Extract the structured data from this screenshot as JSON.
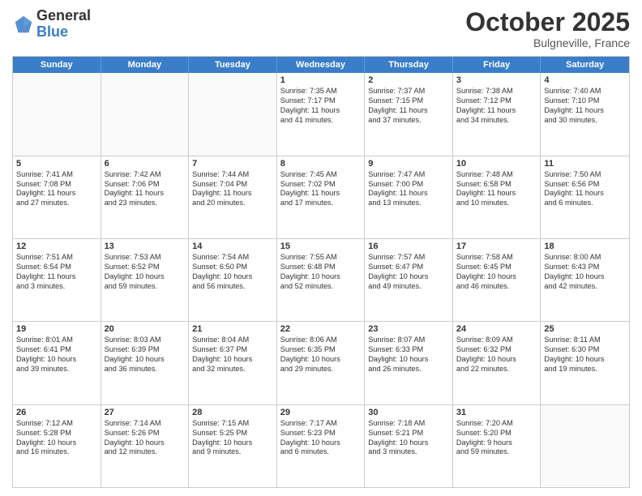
{
  "header": {
    "logo_general": "General",
    "logo_blue": "Blue",
    "month": "October 2025",
    "location": "Bulgneville, France"
  },
  "days_of_week": [
    "Sunday",
    "Monday",
    "Tuesday",
    "Wednesday",
    "Thursday",
    "Friday",
    "Saturday"
  ],
  "rows": [
    [
      {
        "day": "",
        "lines": [],
        "empty": true
      },
      {
        "day": "",
        "lines": [],
        "empty": true
      },
      {
        "day": "",
        "lines": [],
        "empty": true
      },
      {
        "day": "1",
        "lines": [
          "Sunrise: 7:35 AM",
          "Sunset: 7:17 PM",
          "Daylight: 11 hours",
          "and 41 minutes."
        ]
      },
      {
        "day": "2",
        "lines": [
          "Sunrise: 7:37 AM",
          "Sunset: 7:15 PM",
          "Daylight: 11 hours",
          "and 37 minutes."
        ]
      },
      {
        "day": "3",
        "lines": [
          "Sunrise: 7:38 AM",
          "Sunset: 7:12 PM",
          "Daylight: 11 hours",
          "and 34 minutes."
        ]
      },
      {
        "day": "4",
        "lines": [
          "Sunrise: 7:40 AM",
          "Sunset: 7:10 PM",
          "Daylight: 11 hours",
          "and 30 minutes."
        ]
      }
    ],
    [
      {
        "day": "5",
        "lines": [
          "Sunrise: 7:41 AM",
          "Sunset: 7:08 PM",
          "Daylight: 11 hours",
          "and 27 minutes."
        ]
      },
      {
        "day": "6",
        "lines": [
          "Sunrise: 7:42 AM",
          "Sunset: 7:06 PM",
          "Daylight: 11 hours",
          "and 23 minutes."
        ]
      },
      {
        "day": "7",
        "lines": [
          "Sunrise: 7:44 AM",
          "Sunset: 7:04 PM",
          "Daylight: 11 hours",
          "and 20 minutes."
        ]
      },
      {
        "day": "8",
        "lines": [
          "Sunrise: 7:45 AM",
          "Sunset: 7:02 PM",
          "Daylight: 11 hours",
          "and 17 minutes."
        ]
      },
      {
        "day": "9",
        "lines": [
          "Sunrise: 7:47 AM",
          "Sunset: 7:00 PM",
          "Daylight: 11 hours",
          "and 13 minutes."
        ]
      },
      {
        "day": "10",
        "lines": [
          "Sunrise: 7:48 AM",
          "Sunset: 6:58 PM",
          "Daylight: 11 hours",
          "and 10 minutes."
        ]
      },
      {
        "day": "11",
        "lines": [
          "Sunrise: 7:50 AM",
          "Sunset: 6:56 PM",
          "Daylight: 11 hours",
          "and 6 minutes."
        ]
      }
    ],
    [
      {
        "day": "12",
        "lines": [
          "Sunrise: 7:51 AM",
          "Sunset: 6:54 PM",
          "Daylight: 11 hours",
          "and 3 minutes."
        ]
      },
      {
        "day": "13",
        "lines": [
          "Sunrise: 7:53 AM",
          "Sunset: 6:52 PM",
          "Daylight: 10 hours",
          "and 59 minutes."
        ]
      },
      {
        "day": "14",
        "lines": [
          "Sunrise: 7:54 AM",
          "Sunset: 6:50 PM",
          "Daylight: 10 hours",
          "and 56 minutes."
        ]
      },
      {
        "day": "15",
        "lines": [
          "Sunrise: 7:55 AM",
          "Sunset: 6:48 PM",
          "Daylight: 10 hours",
          "and 52 minutes."
        ]
      },
      {
        "day": "16",
        "lines": [
          "Sunrise: 7:57 AM",
          "Sunset: 6:47 PM",
          "Daylight: 10 hours",
          "and 49 minutes."
        ]
      },
      {
        "day": "17",
        "lines": [
          "Sunrise: 7:58 AM",
          "Sunset: 6:45 PM",
          "Daylight: 10 hours",
          "and 46 minutes."
        ]
      },
      {
        "day": "18",
        "lines": [
          "Sunrise: 8:00 AM",
          "Sunset: 6:43 PM",
          "Daylight: 10 hours",
          "and 42 minutes."
        ]
      }
    ],
    [
      {
        "day": "19",
        "lines": [
          "Sunrise: 8:01 AM",
          "Sunset: 6:41 PM",
          "Daylight: 10 hours",
          "and 39 minutes."
        ]
      },
      {
        "day": "20",
        "lines": [
          "Sunrise: 8:03 AM",
          "Sunset: 6:39 PM",
          "Daylight: 10 hours",
          "and 36 minutes."
        ]
      },
      {
        "day": "21",
        "lines": [
          "Sunrise: 8:04 AM",
          "Sunset: 6:37 PM",
          "Daylight: 10 hours",
          "and 32 minutes."
        ]
      },
      {
        "day": "22",
        "lines": [
          "Sunrise: 8:06 AM",
          "Sunset: 6:35 PM",
          "Daylight: 10 hours",
          "and 29 minutes."
        ]
      },
      {
        "day": "23",
        "lines": [
          "Sunrise: 8:07 AM",
          "Sunset: 6:33 PM",
          "Daylight: 10 hours",
          "and 26 minutes."
        ]
      },
      {
        "day": "24",
        "lines": [
          "Sunrise: 8:09 AM",
          "Sunset: 6:32 PM",
          "Daylight: 10 hours",
          "and 22 minutes."
        ]
      },
      {
        "day": "25",
        "lines": [
          "Sunrise: 8:11 AM",
          "Sunset: 6:30 PM",
          "Daylight: 10 hours",
          "and 19 minutes."
        ]
      }
    ],
    [
      {
        "day": "26",
        "lines": [
          "Sunrise: 7:12 AM",
          "Sunset: 5:28 PM",
          "Daylight: 10 hours",
          "and 16 minutes."
        ]
      },
      {
        "day": "27",
        "lines": [
          "Sunrise: 7:14 AM",
          "Sunset: 5:26 PM",
          "Daylight: 10 hours",
          "and 12 minutes."
        ]
      },
      {
        "day": "28",
        "lines": [
          "Sunrise: 7:15 AM",
          "Sunset: 5:25 PM",
          "Daylight: 10 hours",
          "and 9 minutes."
        ]
      },
      {
        "day": "29",
        "lines": [
          "Sunrise: 7:17 AM",
          "Sunset: 5:23 PM",
          "Daylight: 10 hours",
          "and 6 minutes."
        ]
      },
      {
        "day": "30",
        "lines": [
          "Sunrise: 7:18 AM",
          "Sunset: 5:21 PM",
          "Daylight: 10 hours",
          "and 3 minutes."
        ]
      },
      {
        "day": "31",
        "lines": [
          "Sunrise: 7:20 AM",
          "Sunset: 5:20 PM",
          "Daylight: 9 hours",
          "and 59 minutes."
        ]
      },
      {
        "day": "",
        "lines": [],
        "empty": true
      }
    ]
  ]
}
